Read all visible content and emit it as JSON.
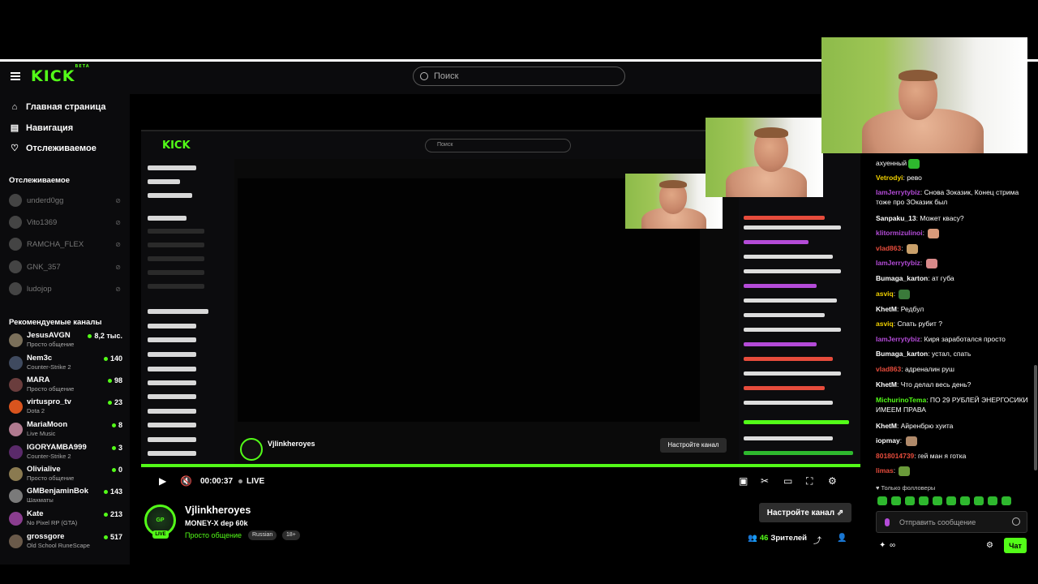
{
  "header": {
    "logo": "KICK",
    "logo_badge": "BETA",
    "search_placeholder": "Поиск"
  },
  "sidebar": {
    "nav": [
      {
        "label": "Главная страница",
        "icon": "home-icon"
      },
      {
        "label": "Навигация",
        "icon": "browse-icon"
      },
      {
        "label": "Отслеживаемое",
        "icon": "heart-icon"
      }
    ],
    "following_title": "Отслеживаемое",
    "following": [
      "underd0gg",
      "Vito1369",
      "RAMCHA_FLEX",
      "GNK_357",
      "ludojop"
    ],
    "recommended_title": "Рекомендуемые каналы",
    "recommended": [
      {
        "name": "JesusAVGN",
        "category": "Просто общение",
        "viewers": "8,2 тыс.",
        "color": "#7a6f5a"
      },
      {
        "name": "Nem3c",
        "category": "Counter-Strike 2",
        "viewers": "140",
        "color": "#3f4a5f"
      },
      {
        "name": "MARA",
        "category": "Просто общение",
        "viewers": "98",
        "color": "#6a3d3d"
      },
      {
        "name": "virtuspro_tv",
        "category": "Dota 2",
        "viewers": "23",
        "color": "#d9541e"
      },
      {
        "name": "MariaMoon",
        "category": "Live Music",
        "viewers": "8",
        "color": "#b07a8f"
      },
      {
        "name": "IGORYAMBA999",
        "category": "Counter-Strike 2",
        "viewers": "3",
        "color": "#5a2a6a"
      },
      {
        "name": "Olivialive",
        "category": "Просто общение",
        "viewers": "0",
        "color": "#8a7a50"
      },
      {
        "name": "GMBenjaminBok",
        "category": "Шахматы",
        "viewers": "143",
        "color": "#7a7a7a"
      },
      {
        "name": "Kate",
        "category": "No Pixel RP (GTA)",
        "viewers": "213",
        "color": "#8a3d8f"
      },
      {
        "name": "grossgore",
        "category": "Old School RuneScape",
        "viewers": "517",
        "color": "#6a5a4a"
      }
    ]
  },
  "nested": {
    "logo": "KICK",
    "search": "Поиск",
    "streamer": "Vjlinkheroyes",
    "button": "Настройте канал"
  },
  "player": {
    "time": "00:00:37",
    "live": "LIVE",
    "progress": 1.0
  },
  "stream": {
    "avatar_text": "GP",
    "live_badge": "LIVE",
    "name": "Vjlinkheroyes",
    "title": "MONEY-X dep 60k",
    "category": "Просто общение",
    "tags": [
      "Russian",
      "18+"
    ],
    "setup_button": "Настройте канал",
    "viewers_count": "46",
    "viewers_label": "Зрителей"
  },
  "chat": {
    "messages": [
      {
        "user": "",
        "text": "ахуенный",
        "color": "#ffffff",
        "emote": "#2eb82e"
      },
      {
        "user": "Vetrodyi",
        "text": "рево",
        "color": "#f0d000"
      },
      {
        "user": "IamJerrytybiz",
        "text": "Снова 3оказик, Конец стрима тоже про 3Оказик был",
        "color": "#b44bd8"
      },
      {
        "user": "Sanpaku_13",
        "text": "Может квасу?",
        "color": "#ffffff"
      },
      {
        "user": "klitormizulinoi",
        "text": "",
        "color": "#b44bd8",
        "emote": "#d99a7a"
      },
      {
        "user": "vlad863",
        "text": "",
        "color": "#e74c3c",
        "emote": "#c9a06a"
      },
      {
        "user": "IamJerrytybiz",
        "text": "",
        "color": "#b44bd8",
        "emote": "#d98a8a"
      },
      {
        "user": "Bumaga_karton",
        "text": "ат губа",
        "color": "#ffffff"
      },
      {
        "user": "asviq",
        "text": "",
        "color": "#f0d000",
        "emote": "#3a7a3a"
      },
      {
        "user": "KhetM",
        "text": "Редбул",
        "color": "#ffffff"
      },
      {
        "user": "asviq",
        "text": "Спать рубит ?",
        "color": "#f0d000"
      },
      {
        "user": "IamJerrytybiz",
        "text": "Киря заработался просто",
        "color": "#b44bd8"
      },
      {
        "user": "Bumaga_karton",
        "text": "устал, спать",
        "color": "#ffffff"
      },
      {
        "user": "vlad863",
        "text": "адреналин руш",
        "color": "#e74c3c"
      },
      {
        "user": "KhetM",
        "text": "Что делал весь день?",
        "color": "#ffffff"
      },
      {
        "user": "MichurinoTema",
        "text": "ПО 29 РУБЛЕЙ ЭНЕРГОСИКИ ИМЕЕМ ПРАВА",
        "color": "#53fc18"
      },
      {
        "user": "KhetM",
        "text": "Айренбрю хуита",
        "color": "#ffffff"
      },
      {
        "user": "iopmay",
        "text": "",
        "color": "#ffffff",
        "emote": "#b08a6a"
      },
      {
        "user": "8018014739",
        "text": "гей ман я готка",
        "color": "#e74c3c"
      },
      {
        "user": "limas",
        "text": "",
        "color": "#e74c3c",
        "emote": "#6a9a3a"
      }
    ],
    "followers_only": "Только фолловеры",
    "input_placeholder": "Отправить сообщение",
    "send_button": "Чат",
    "infinity": "∞"
  }
}
